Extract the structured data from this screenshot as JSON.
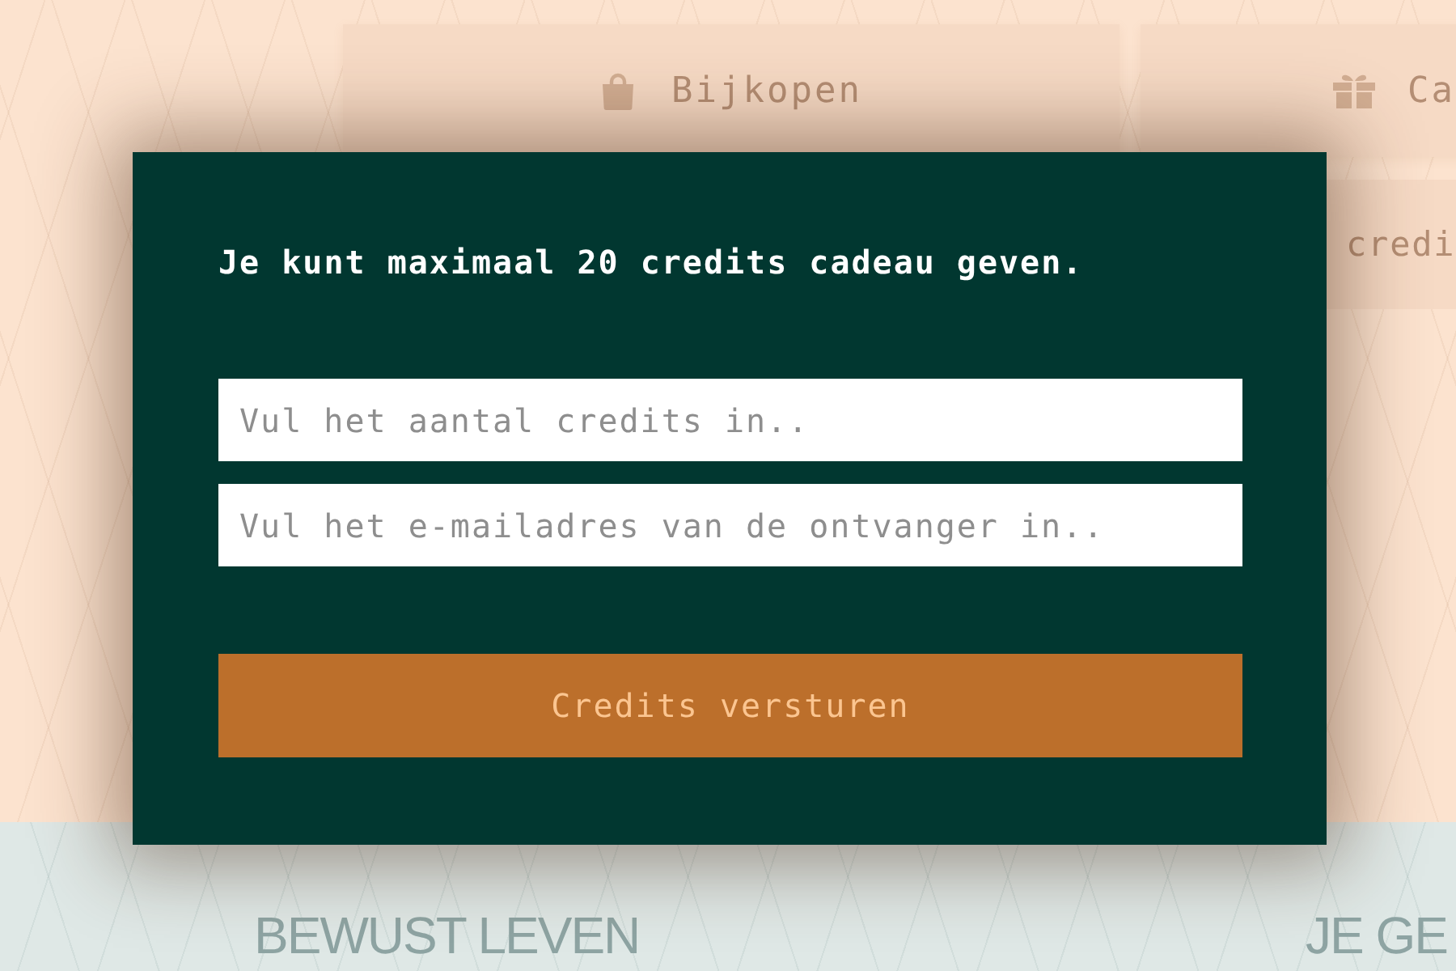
{
  "background": {
    "tabs": [
      {
        "kind": "bag",
        "label": "Bijkopen"
      },
      {
        "kind": "gift",
        "label": "Ca"
      }
    ],
    "card_text": "credi",
    "headings": [
      "BEWUST LEVEN",
      "JE GE"
    ]
  },
  "dialog": {
    "message": "Je kunt maximaal 20 credits cadeau geven.",
    "fields": [
      {
        "placeholder": "Vul het aantal credits in.."
      },
      {
        "placeholder": "Vul het e-mailadres van de ontvanger in.."
      }
    ],
    "submit_button": "Credits versturen"
  }
}
